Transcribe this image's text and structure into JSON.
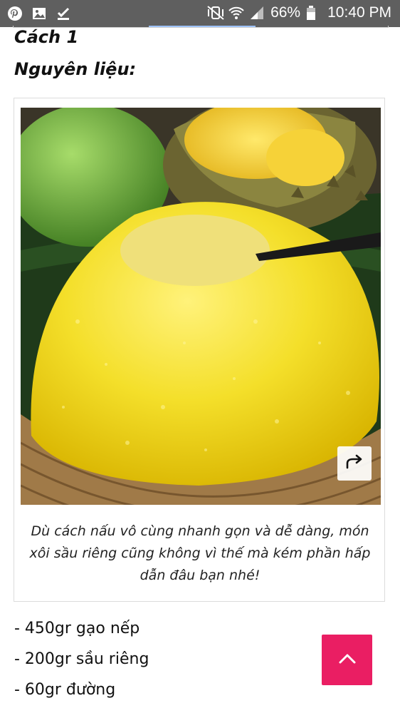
{
  "status_bar": {
    "battery_percent": "66%",
    "time": "10:40 PM",
    "left_icons": [
      "pinterest-icon",
      "image-icon",
      "download-done-icon"
    ],
    "right_icons": [
      "mute-vibrate-icon",
      "wifi-icon",
      "signal-icon",
      "battery-icon"
    ]
  },
  "article": {
    "method_heading": "Cách 1",
    "ingredients_heading": "Nguyên liệu:",
    "figure": {
      "image_alt": "Xôi sầu riêng",
      "caption": "Dù cách nấu vô cùng nhanh gọn và dễ dàng, món xôi sầu riêng cũng không vì thế mà kém phần hấp dẫn đâu bạn nhé!",
      "share_icon": "share-arrow-icon"
    },
    "ingredients": [
      "- 450gr gạo nếp",
      "- 200gr sầu riêng",
      "- 60gr đường"
    ]
  },
  "fab": {
    "icon": "chevron-up-icon",
    "color": "#ea1e63"
  }
}
